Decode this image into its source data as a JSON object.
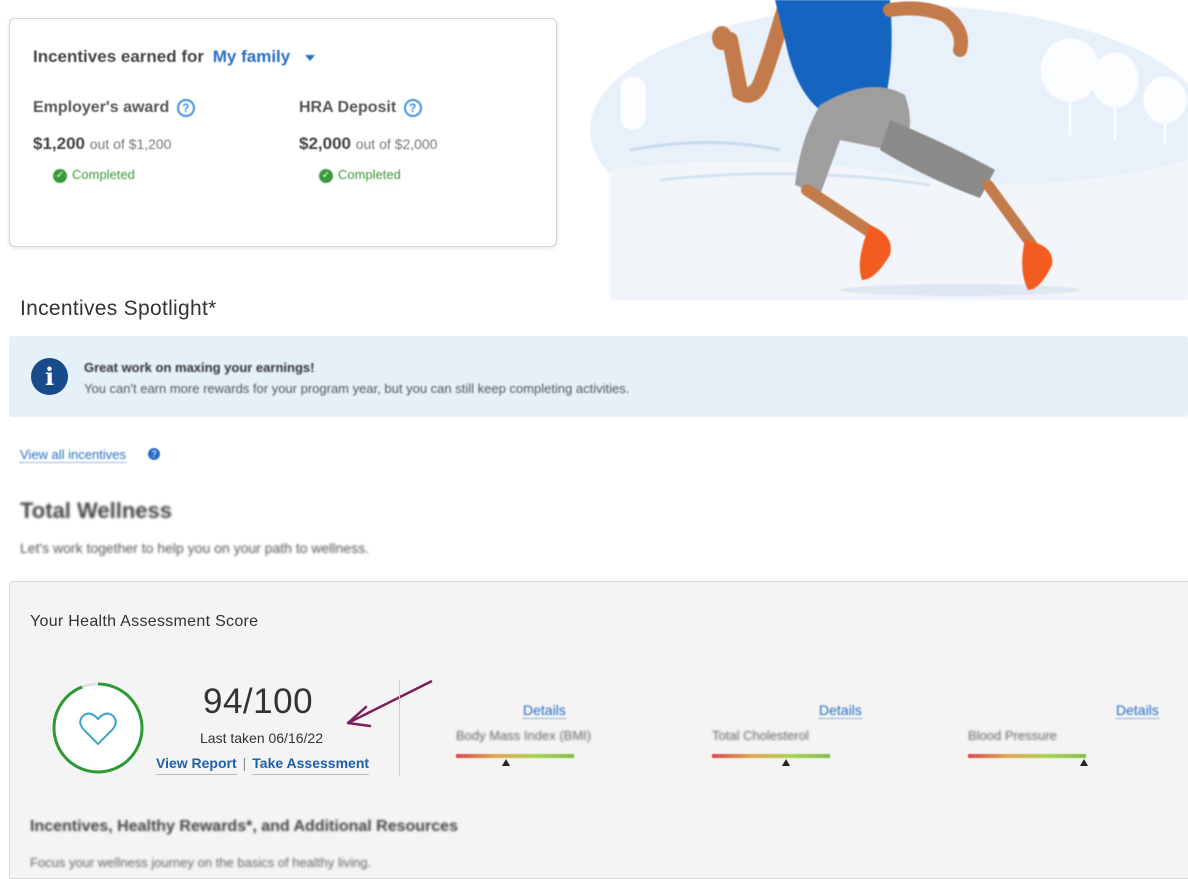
{
  "incentives": {
    "title_prefix": "Incentives earned for",
    "family_select": "My family",
    "awards": [
      {
        "label": "Employer's award",
        "help": "?",
        "earned": "$1,200",
        "out_of": "out of $1,200",
        "status": "Completed",
        "status_icon": "check-circle-icon"
      },
      {
        "label": "HRA Deposit",
        "help": "?",
        "earned": "$2,000",
        "out_of": "out of $2,000",
        "status": "Completed",
        "status_icon": "check-circle-icon"
      }
    ]
  },
  "hero": {
    "image": "runner-illustration",
    "colors": {
      "shirt": "#1565c0",
      "shoes": "#f25c20",
      "background": "#e8f0fa"
    }
  },
  "spotlight": {
    "title": "Incentives Spotlight*",
    "banner": {
      "icon": "info-icon",
      "heading": "Great work on maxing your earnings!",
      "text": "You can't earn more rewards for your program year, but you can still keep completing activities."
    },
    "view_all": "View all incentives"
  },
  "wellness": {
    "title": "Total Wellness",
    "subtitle": "Let's work together to help you on your path to wellness."
  },
  "assessment": {
    "title": "Your Health Assessment Score",
    "score": "94/100",
    "score_fraction": 0.94,
    "last_taken": "Last taken 06/16/22",
    "view_report": "View Report",
    "separator": "|",
    "take_assessment": "Take Assessment",
    "metrics": [
      {
        "details": "Details",
        "name": "Body Mass Index (BMI)",
        "level": 0.42
      },
      {
        "details": "Details",
        "name": "Total Cholesterol",
        "level": 0.63
      },
      {
        "details": "Details",
        "name": "Blood Pressure",
        "level": 0.98
      }
    ]
  },
  "resources": {
    "title": "Incentives, Healthy Rewards*, and Additional Resources",
    "subtitle": "Focus your wellness journey on the basics of healthy living."
  },
  "colors": {
    "accent": "#2a6fc2",
    "success": "#3a9a3a",
    "ring": "#2e9a36",
    "heart": "#3aa7c9",
    "annotation_arrow": "#7a1f5c"
  }
}
